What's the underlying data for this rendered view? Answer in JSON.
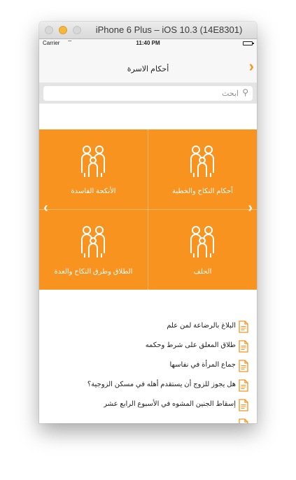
{
  "window": {
    "title": "iPhone 6 Plus – iOS 10.3 (14E8301)"
  },
  "status": {
    "carrier": "Carrier",
    "time": "11:40 PM"
  },
  "nav": {
    "title": "أحكام الاسرة"
  },
  "search": {
    "placeholder": "ابحث"
  },
  "categories": [
    {
      "label": "أحكام النكاح والخطبة"
    },
    {
      "label": "الأنكحة الفاسدة"
    },
    {
      "label": "الحلف"
    },
    {
      "label": "الطلاق وطرق النكاح والعدة"
    }
  ],
  "articles": [
    "البلاغ بالرضاعة لمن علم",
    "طلاق المعلق على شرط وحكمه",
    "جماع المرأة في نفاسها",
    "هل يجوز للزوج أن يستقدم أهله في مسكن الزوجية؟",
    "إسقاط الجنين المشوه في الأسبوع الرابع عشر"
  ],
  "colors": {
    "accent": "#f7931e",
    "icon": "family-icon"
  }
}
